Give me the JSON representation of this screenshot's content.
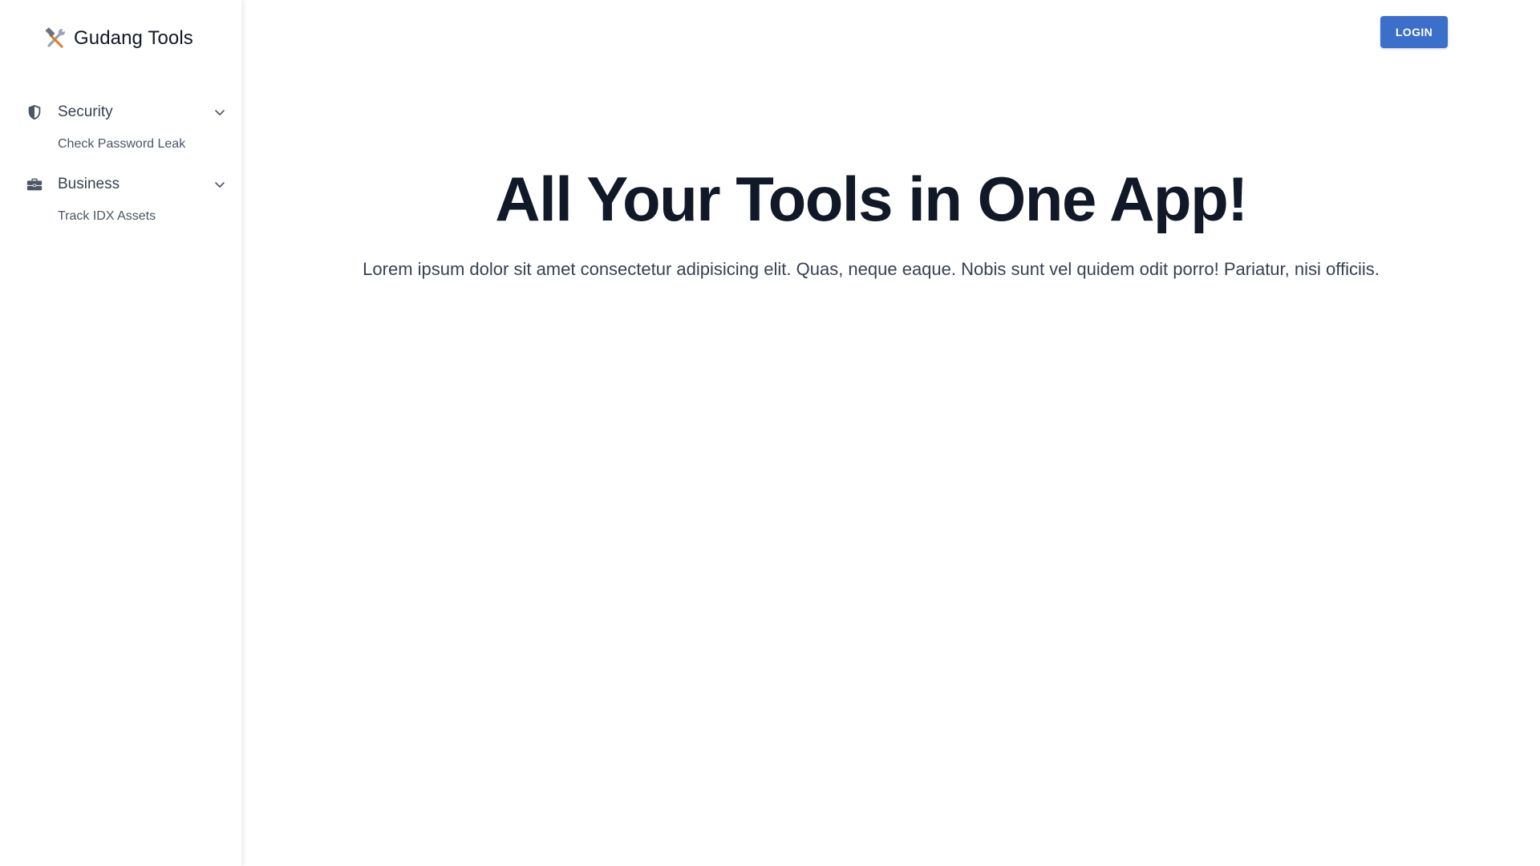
{
  "app": {
    "name": "Gudang Tools",
    "logo_icon": "hammer-and-wrench-icon"
  },
  "sidebar": {
    "groups": [
      {
        "label": "Security",
        "icon": "shield-icon",
        "expanded": true,
        "items": [
          {
            "label": "Check Password Leak"
          }
        ]
      },
      {
        "label": "Business",
        "icon": "briefcase-icon",
        "expanded": true,
        "items": [
          {
            "label": "Track IDX Assets"
          }
        ]
      }
    ]
  },
  "header": {
    "login_label": "LOGIN"
  },
  "hero": {
    "title": "All Your Tools in One App!",
    "subtitle": "Lorem ipsum dolor sit amet consectetur adipisicing elit. Quas, neque eaque. Nobis sunt vel quidem odit porro! Pariatur, nisi officiis."
  },
  "colors": {
    "accent": "#3b6fc9",
    "text_dark": "#111827",
    "text_body": "#374151"
  }
}
